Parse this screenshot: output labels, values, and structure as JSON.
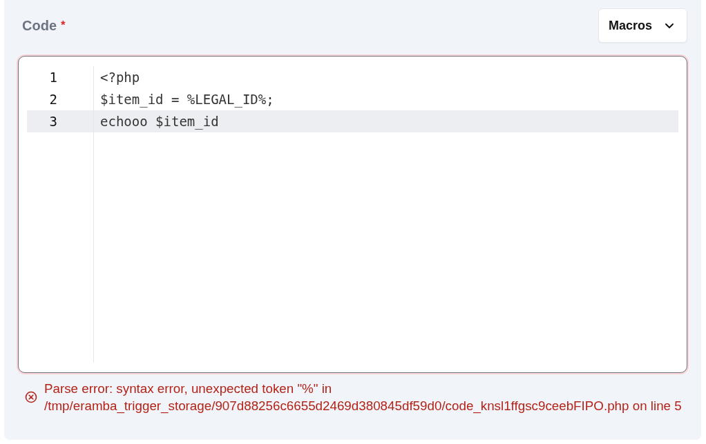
{
  "field": {
    "label": "Code",
    "required_mark": "*",
    "has_error": true
  },
  "macros_button": {
    "label": "Macros"
  },
  "editor": {
    "lines": [
      {
        "number": "1",
        "code": "<?php",
        "active": false
      },
      {
        "number": "2",
        "code": "$item_id = %LEGAL_ID%;",
        "active": false
      },
      {
        "number": "3",
        "code": "echooo $item_id",
        "active": true
      }
    ]
  },
  "error_message": "Parse error: syntax error, unexpected token \"%\" in /tmp/eramba_trigger_storage/907d88256c6655d2469d380845df59d0/code_knsl1ffgsc9ceebFIPO.php on line 5"
}
